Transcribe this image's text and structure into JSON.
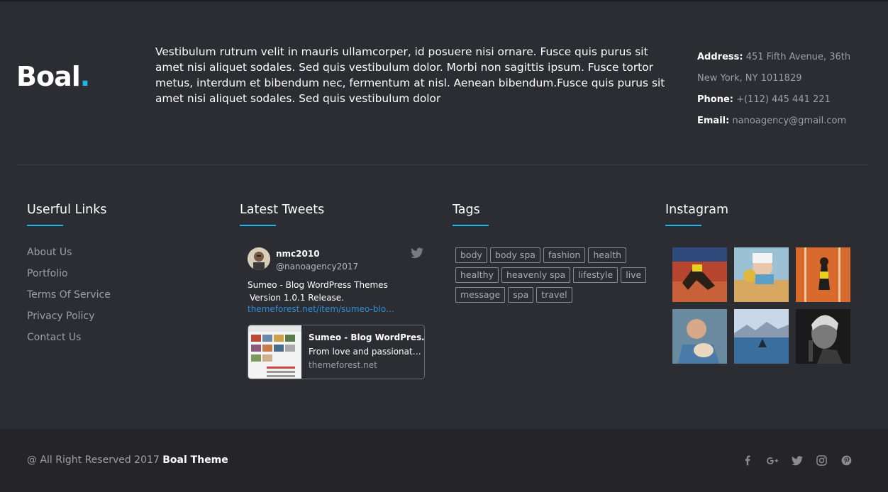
{
  "logo": {
    "text": "Boal",
    "dot": "."
  },
  "intro": "Vestibulum rutrum velit in mauris ullamcorper, id posuere nisi ornare. Fusce quis purus sit amet nisi aliquet sodales. Sed quis vestibulum dolor. Morbi non sagittis ipsum. Fusce tortor metus, interdum et bibendum nec, fermentum at nisl. Aenean bibendum.Fusce quis purus sit amet nisi aliquet sodales. Sed quis vestibulum dolor",
  "contact": {
    "address_label": "Address:",
    "address_line1": "451 Fifth Avenue, 36th",
    "address_line2": "New York, NY 1011829",
    "phone_label": "Phone:",
    "phone": "+(112)  445 441 221",
    "email_label": "Email:",
    "email": "nanoagency@gmail.com"
  },
  "columns": {
    "links_title": "Userful Links",
    "tweets_title": "Latest Tweets",
    "tags_title": "Tags",
    "instagram_title": "Instagram"
  },
  "links": [
    "About Us",
    "Portfolio",
    "Terms Of Service",
    "Privacy Policy",
    "Contact Us"
  ],
  "tweet": {
    "name": "nmc2010",
    "handle": "@nanoagency2017",
    "text_line1": "Sumeo - Blog WordPress Themes",
    "text_line2": "Version 1.0.1 Release.",
    "link": "themeforest.net/item/sumeo-blo…",
    "card_title": "Sumeo - Blog WordPres…",
    "card_desc": "From love and passionat…",
    "card_url": "themeforest.net"
  },
  "tags": [
    "body",
    "body spa",
    "fashion",
    "health",
    "healthy",
    "heavenly spa",
    "lifestyle",
    "live",
    "message",
    "spa",
    "travel"
  ],
  "footer": {
    "copyright": "@ All Right Reserved 2017",
    "brand": "Boal Theme"
  },
  "icons": {
    "twitter": "twitter-icon",
    "social": [
      "facebook-icon",
      "google-plus-icon",
      "twitter-icon",
      "instagram-icon",
      "pinterest-icon"
    ]
  },
  "colors": {
    "accent": "#1fb6e8",
    "background": "#2c2c33",
    "footer": "#252529",
    "link": "#2d8fd5"
  }
}
